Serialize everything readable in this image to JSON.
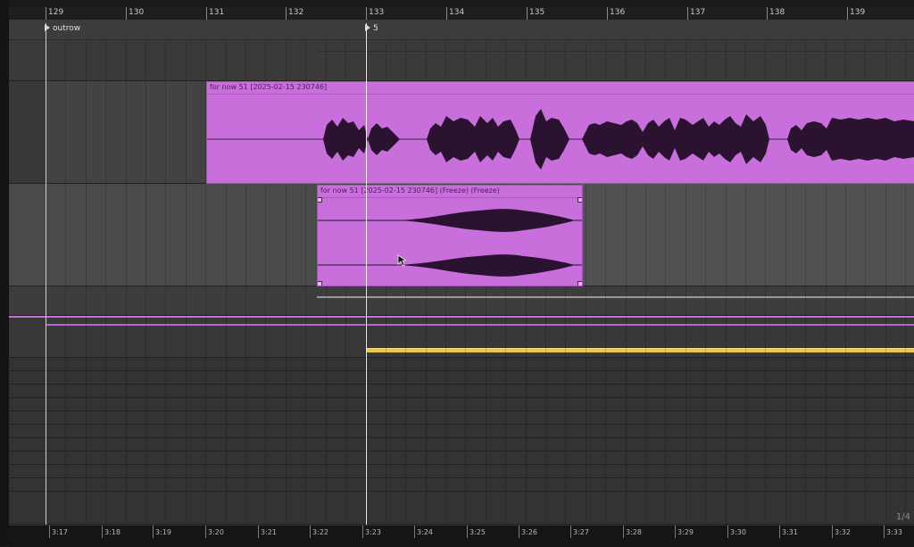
{
  "bar_ruler": {
    "bars": [
      "129",
      "130",
      "131",
      "132",
      "133",
      "134",
      "135",
      "136",
      "137",
      "138",
      "139"
    ]
  },
  "locators": {
    "outrow": "outrow",
    "marker5": "5"
  },
  "clips": {
    "main": {
      "title": "for now 51 [2025-02-15 230746]",
      "color": "#c96fdc"
    },
    "freeze": {
      "title": "for now 51 [2025-02-15 230746] (Freeze) (Freeze)",
      "color": "#c96fdc"
    }
  },
  "automation": {
    "purple_line_color": "#c96fdc",
    "yellow_line_color": "#e8c948"
  },
  "time_ruler": {
    "labels": [
      "3:17",
      "3:18",
      "3:19",
      "3:20",
      "3:21",
      "3:22",
      "3:23",
      "3:24",
      "3:25",
      "3:26",
      "3:27",
      "3:28",
      "3:29",
      "3:30",
      "3:31",
      "3:32",
      "3:33"
    ]
  },
  "page_indicator": "1/4"
}
